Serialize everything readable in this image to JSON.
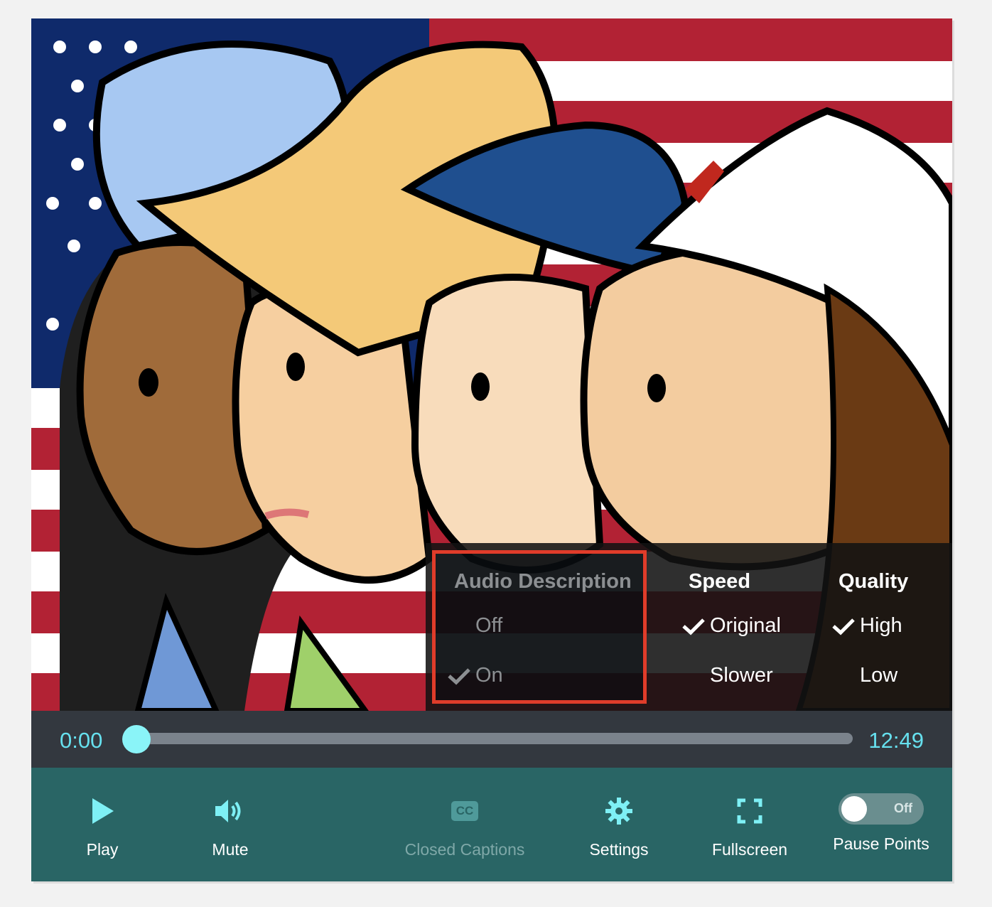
{
  "settings": {
    "audio_description": {
      "heading": "Audio Description",
      "options": [
        {
          "label": "Off",
          "selected": false
        },
        {
          "label": "On",
          "selected": true
        }
      ]
    },
    "speed": {
      "heading": "Speed",
      "options": [
        {
          "label": "Original",
          "selected": true
        },
        {
          "label": "Slower",
          "selected": false
        }
      ]
    },
    "quality": {
      "heading": "Quality",
      "options": [
        {
          "label": "High",
          "selected": true
        },
        {
          "label": "Low",
          "selected": false
        }
      ]
    }
  },
  "progress": {
    "current_time": "0:00",
    "duration": "12:49",
    "fraction": 0.0
  },
  "controls": {
    "play_label": "Play",
    "mute_label": "Mute",
    "captions_label": "Closed Captions",
    "captions_icon_text": "CC",
    "settings_label": "Settings",
    "fullscreen_label": "Fullscreen",
    "pause_points_label": "Pause Points",
    "pause_points_state": "Off"
  },
  "icons": {
    "play": "play-icon",
    "mute": "speaker-icon",
    "captions": "cc-icon",
    "settings": "gear-icon",
    "fullscreen": "fullscreen-icon",
    "check": "checkmark-icon"
  },
  "colors": {
    "control_bar": "#296565",
    "scrub_bar": "#33383f",
    "accent": "#66e0ee",
    "highlight_border": "#e03c2a"
  }
}
